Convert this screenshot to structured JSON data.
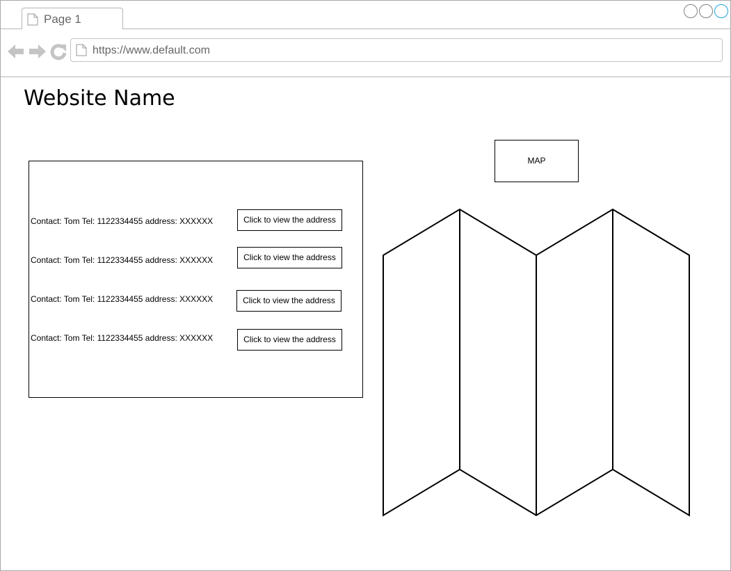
{
  "browser": {
    "tab_label": "Page 1",
    "url": "https://www.default.com"
  },
  "page": {
    "site_title": "Website Name"
  },
  "contacts": [
    {
      "text": "Contact: Tom Tel: 1122334455 address: XXXXXX",
      "button_label": "Click to view the address"
    },
    {
      "text": "Contact: Tom Tel: 1122334455 address: XXXXXX",
      "button_label": "Click to view the address"
    },
    {
      "text": "Contact: Tom Tel: 1122334455 address: XXXXXX",
      "button_label": "Click to view the address"
    },
    {
      "text": "Contact: Tom Tel: 1122334455 address: XXXXXX",
      "button_label": "Click to view the address"
    }
  ],
  "map": {
    "label": "MAP",
    "icon": "folded-map-icon"
  },
  "icons": {
    "back": "back-arrow-icon",
    "forward": "forward-arrow-icon",
    "reload": "reload-icon",
    "page": "page-icon"
  },
  "colors": {
    "active_window_control": "#1ea0e0",
    "chrome_gray": "#b5b5b5"
  }
}
